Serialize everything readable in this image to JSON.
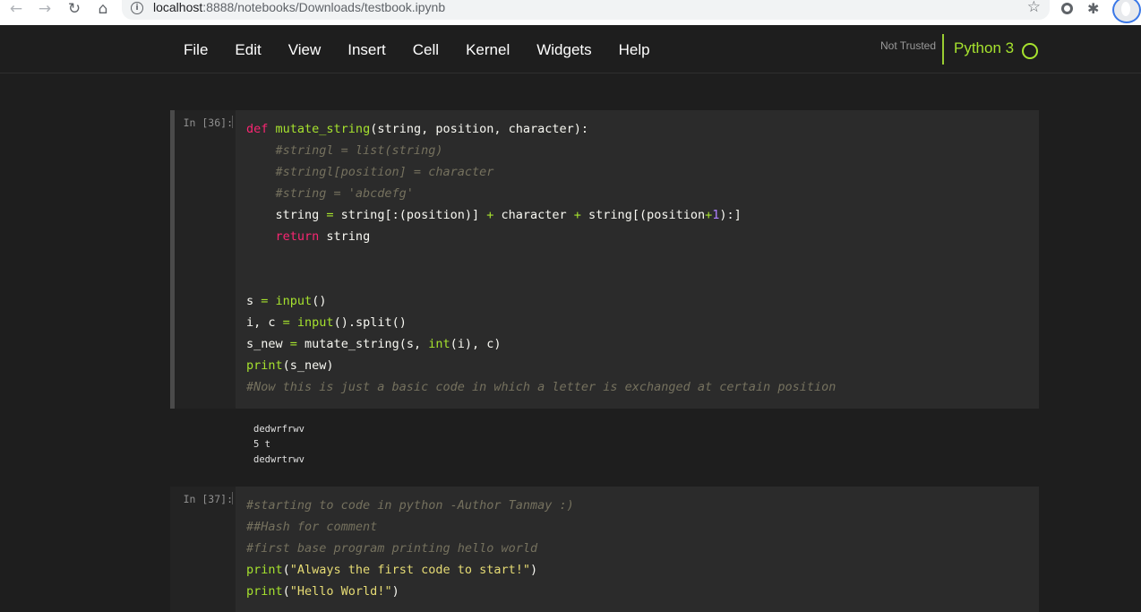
{
  "browser": {
    "back_icon": "←",
    "forward_icon": "→",
    "reload_icon": "↻",
    "home_icon": "⌂",
    "info_icon": "i",
    "url_host": "localhost",
    "url_rest": ":8888/notebooks/Downloads/testbook.ipynb",
    "star_icon": "☆",
    "extension_icon": "✱"
  },
  "menubar": {
    "items": [
      "File",
      "Edit",
      "View",
      "Insert",
      "Cell",
      "Kernel",
      "Widgets",
      "Help"
    ],
    "trust_status": "Not Trusted",
    "kernel_name": "Python 3"
  },
  "cells": [
    {
      "prompt": "In [36]:",
      "code_lines": [
        "def mutate_string(string, position, character):",
        "    #stringl = list(string)",
        "    #stringl[position] = character",
        "    #string = 'abcdefg'",
        "    string = string[:(position)] + character + string[(position+1):]",
        "    return string",
        "",
        "",
        "s = input()",
        "i, c = input().split()",
        "s_new = mutate_string(s, int(i), c)",
        "print(s_new)",
        "#Now this is just a basic code in which a letter is exchanged at certain position"
      ],
      "output_lines": [
        "dedwrfrwv",
        "5 t",
        "dedwrtrwv"
      ]
    },
    {
      "prompt": "In [37]:",
      "code_lines": [
        "#starting to code in python -Author Tanmay :)",
        "##Hash for comment",
        "#first base program printing hello world",
        "print(\"Always the first code to start!\")",
        "print(\"Hello World!\")"
      ]
    }
  ],
  "colors": {
    "background": "#1e1e1e",
    "keyword": "#f92672",
    "function": "#a6e22e",
    "comment": "#75715e",
    "number": "#ae81ff",
    "string": "#e6db74",
    "kernel": "#a6e22e"
  }
}
